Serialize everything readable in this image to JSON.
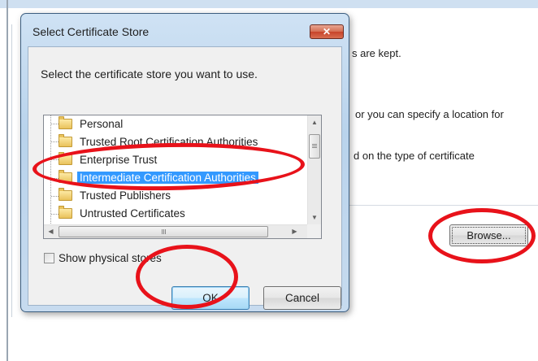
{
  "background_page": {
    "line1": "s are kept.",
    "line2": "or you can specify a location for",
    "line3": "d on the type of certificate",
    "browse_label": "Browse..."
  },
  "dialog": {
    "title": "Select Certificate Store",
    "close_glyph": "✕",
    "prompt": "Select the certificate store you want to use.",
    "tree_items": [
      {
        "label": "Personal"
      },
      {
        "label": "Trusted Root Certification Authorities"
      },
      {
        "label": "Enterprise Trust"
      },
      {
        "label": "Intermediate Certification Authorities",
        "selected": true
      },
      {
        "label": "Trusted Publishers"
      },
      {
        "label": "Untrusted Certificates"
      }
    ],
    "scroll_grip": "III",
    "show_physical_stores_label": "Show physical stores",
    "show_physical_stores_checked": false,
    "ok_label": "OK",
    "cancel_label": "Cancel"
  },
  "annotation_color": "#e8121a",
  "icons": [
    "folder-icon",
    "close-icon",
    "scroll-up-arrow-icon",
    "scroll-down-arrow-icon",
    "scroll-left-arrow-icon",
    "scroll-right-arrow-icon"
  ]
}
